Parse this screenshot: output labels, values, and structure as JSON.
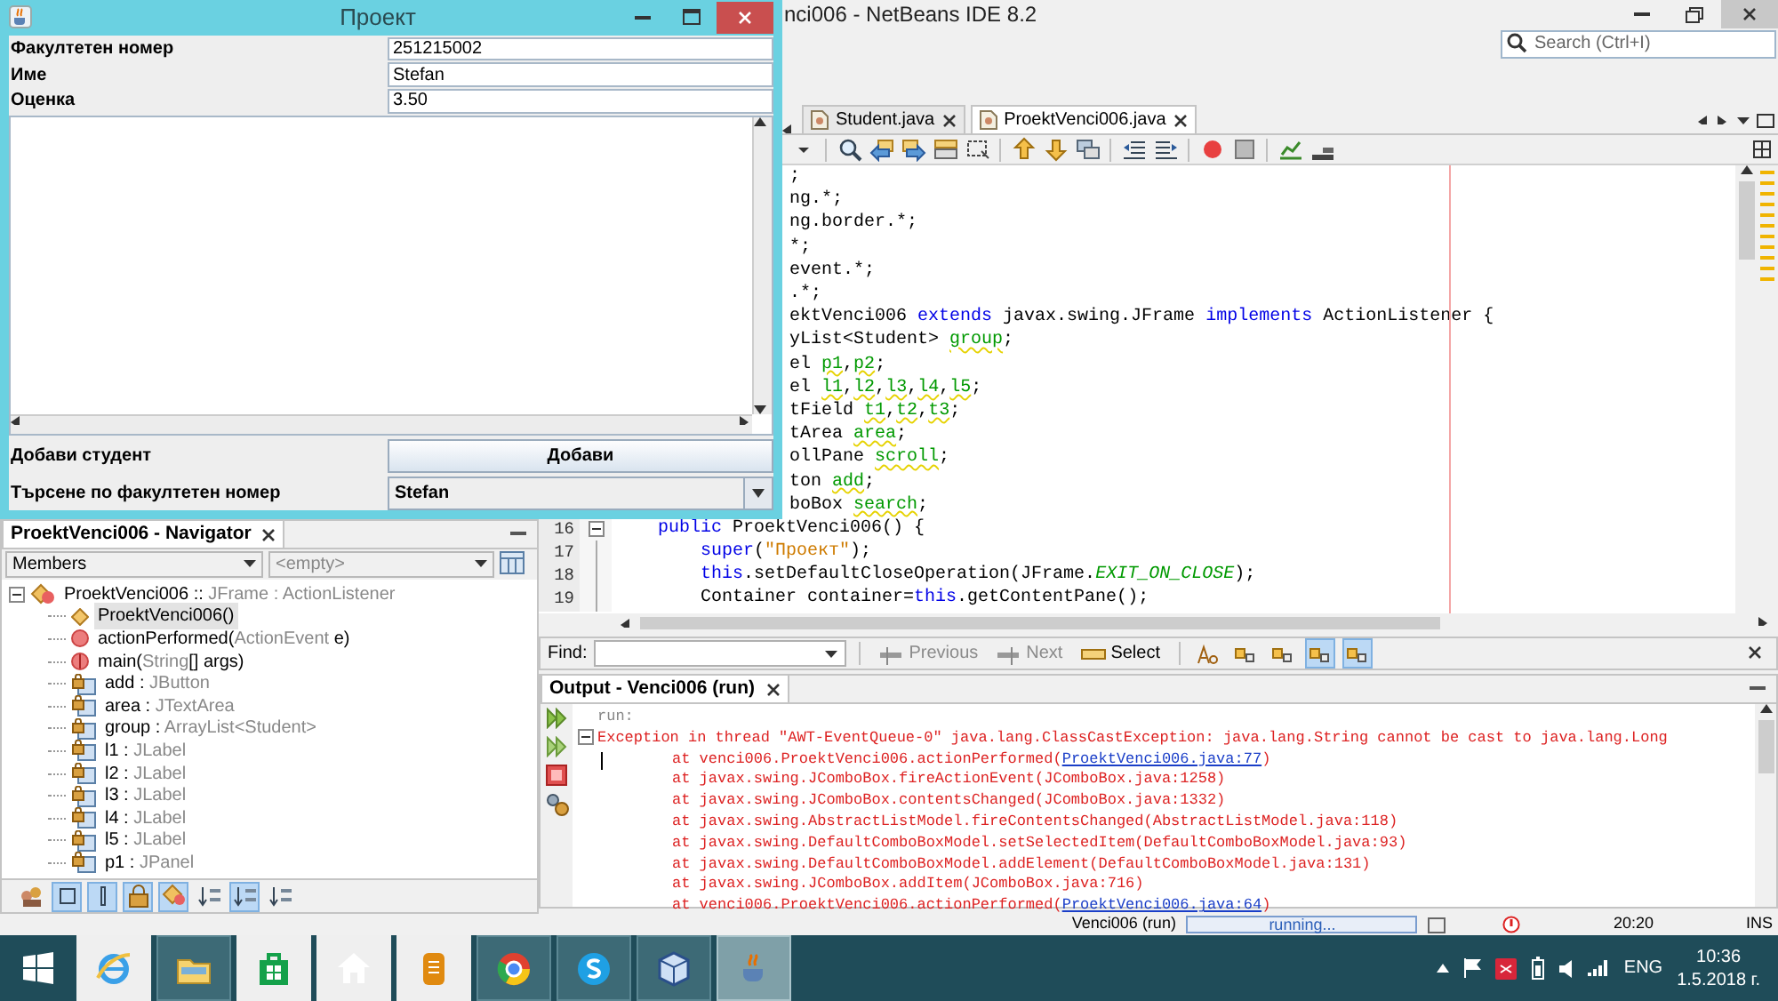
{
  "java_window": {
    "title": "Проект",
    "form": [
      {
        "label": "Факултетен номер",
        "value": "251215002"
      },
      {
        "label": "Име",
        "value": "Stefan"
      },
      {
        "label": "Оценка",
        "value": "3.50"
      }
    ],
    "add_label": "Добави студент",
    "add_button": "Добави",
    "search_label": "Търсене по факултетен номер",
    "search_value": "Stefan"
  },
  "ide": {
    "title": "nci006 - NetBeans IDE 8.2",
    "search": {
      "placeholder": "Search (Ctrl+I)"
    },
    "editor_tabs": [
      {
        "label": "Student.java",
        "selected": false
      },
      {
        "label": "ProektVenci006.java",
        "selected": true
      }
    ],
    "code_lines": [
      {
        "tokens": [
          {
            "text": ";",
            "kind": "plain"
          }
        ]
      },
      {
        "tokens": [
          {
            "text": "ng.*;",
            "kind": "plain"
          }
        ]
      },
      {
        "tokens": [
          {
            "text": "ng.border.*;",
            "kind": "plain"
          }
        ]
      },
      {
        "tokens": [
          {
            "text": "*;",
            "kind": "plain"
          }
        ]
      },
      {
        "tokens": [
          {
            "text": "event.*;",
            "kind": "plain"
          }
        ]
      },
      {
        "tokens": [
          {
            "text": ".*;",
            "kind": "plain"
          }
        ]
      },
      {
        "tokens": [
          {
            "text": "ektVenci006 ",
            "kind": "plain"
          },
          {
            "text": "extends",
            "kind": "keyword"
          },
          {
            "text": " javax.swing.JFrame ",
            "kind": "plain"
          },
          {
            "text": "implements",
            "kind": "keyword"
          },
          {
            "text": " ActionListener {",
            "kind": "plain"
          }
        ]
      },
      {
        "tokens": [
          {
            "text": "yList<Student> ",
            "kind": "plain"
          },
          {
            "text": "group",
            "kind": "field"
          },
          {
            "text": ";",
            "kind": "plain"
          }
        ]
      },
      {
        "tokens": [
          {
            "text": "el ",
            "kind": "plain"
          },
          {
            "text": "p1",
            "kind": "field"
          },
          {
            "text": ",",
            "kind": "plain"
          },
          {
            "text": "p2",
            "kind": "field"
          },
          {
            "text": ";",
            "kind": "plain"
          }
        ]
      },
      {
        "tokens": [
          {
            "text": "el ",
            "kind": "plain"
          },
          {
            "text": "l1",
            "kind": "field"
          },
          {
            "text": ",",
            "kind": "plain"
          },
          {
            "text": "l2",
            "kind": "field"
          },
          {
            "text": ",",
            "kind": "plain"
          },
          {
            "text": "l3",
            "kind": "field"
          },
          {
            "text": ",",
            "kind": "plain"
          },
          {
            "text": "l4",
            "kind": "field"
          },
          {
            "text": ",",
            "kind": "plain"
          },
          {
            "text": "l5",
            "kind": "field"
          },
          {
            "text": ";",
            "kind": "plain"
          }
        ]
      },
      {
        "tokens": [
          {
            "text": "tField ",
            "kind": "plain"
          },
          {
            "text": "t1",
            "kind": "field"
          },
          {
            "text": ",",
            "kind": "plain"
          },
          {
            "text": "t2",
            "kind": "field"
          },
          {
            "text": ",",
            "kind": "plain"
          },
          {
            "text": "t3",
            "kind": "field"
          },
          {
            "text": ";",
            "kind": "plain"
          }
        ]
      },
      {
        "tokens": [
          {
            "text": "tArea ",
            "kind": "plain"
          },
          {
            "text": "area",
            "kind": "field"
          },
          {
            "text": ";",
            "kind": "plain"
          }
        ]
      },
      {
        "tokens": [
          {
            "text": "ollPane ",
            "kind": "plain"
          },
          {
            "text": "scroll",
            "kind": "field"
          },
          {
            "text": ";",
            "kind": "plain"
          }
        ]
      },
      {
        "tokens": [
          {
            "text": "ton ",
            "kind": "plain"
          },
          {
            "text": "add",
            "kind": "field"
          },
          {
            "text": ";",
            "kind": "plain"
          }
        ]
      },
      {
        "tokens": [
          {
            "text": "boBox ",
            "kind": "plain"
          },
          {
            "text": "search",
            "kind": "field"
          },
          {
            "text": ";",
            "kind": "plain"
          }
        ]
      },
      {
        "number": "16",
        "fold": true,
        "tokens": [
          {
            "text": "    public",
            "kind": "keyword"
          },
          {
            "text": " ProektVenci006() {",
            "kind": "plain"
          }
        ]
      },
      {
        "number": "17",
        "fold": false,
        "tokens": [
          {
            "text": "        super",
            "kind": "keyword"
          },
          {
            "text": "(",
            "kind": "plain"
          },
          {
            "text": "\"Проект\"",
            "kind": "string"
          },
          {
            "text": ");",
            "kind": "plain"
          }
        ]
      },
      {
        "number": "18",
        "fold": false,
        "tokens": [
          {
            "text": "        this",
            "kind": "keyword"
          },
          {
            "text": ".setDefaultCloseOperation(JFrame.",
            "kind": "plain"
          },
          {
            "text": "EXIT_ON_CLOSE",
            "kind": "constant"
          },
          {
            "text": ");",
            "kind": "plain"
          }
        ]
      },
      {
        "number": "19",
        "fold": false,
        "tokens": [
          {
            "text": "        Container container=",
            "kind": "plain"
          },
          {
            "text": "this",
            "kind": "keyword"
          },
          {
            "text": ".getContentPane();",
            "kind": "plain"
          }
        ]
      }
    ],
    "find_bar": {
      "label": "Find:",
      "buttons": [
        {
          "label": "Previous",
          "disabled": true
        },
        {
          "label": "Next",
          "disabled": true
        },
        {
          "label": "Select",
          "disabled": false
        }
      ]
    },
    "output": {
      "tab": "Output - Venci006 (run)",
      "lines": [
        {
          "kind": "info",
          "parts": [
            {
              "text": "run:",
              "link": false
            }
          ]
        },
        {
          "kind": "error",
          "parts": [
            {
              "text": "Exception in thread \"AWT-EventQueue-0\" java.lang.ClassCastException: java.lang.String cannot be cast to java.lang.Long",
              "link": false
            }
          ]
        },
        {
          "kind": "stack",
          "parts": [
            {
              "text": "at venci006.ProektVenci006.actionPerformed(",
              "link": false
            },
            {
              "text": "ProektVenci006.java:77",
              "link": true
            },
            {
              "text": ")",
              "link": false
            }
          ]
        },
        {
          "kind": "stack",
          "parts": [
            {
              "text": "at javax.swing.JComboBox.fireActionEvent(JComboBox.java:1258)",
              "link": false
            }
          ]
        },
        {
          "kind": "stack",
          "parts": [
            {
              "text": "at javax.swing.JComboBox.contentsChanged(JComboBox.java:1332)",
              "link": false
            }
          ]
        },
        {
          "kind": "stack",
          "parts": [
            {
              "text": "at javax.swing.AbstractListModel.fireContentsChanged(AbstractListModel.java:118)",
              "link": false
            }
          ]
        },
        {
          "kind": "stack",
          "parts": [
            {
              "text": "at javax.swing.DefaultComboBoxModel.setSelectedItem(DefaultComboBoxModel.java:93)",
              "link": false
            }
          ]
        },
        {
          "kind": "stack",
          "parts": [
            {
              "text": "at javax.swing.DefaultComboBoxModel.addElement(DefaultComboBoxModel.java:131)",
              "link": false
            }
          ]
        },
        {
          "kind": "stack",
          "parts": [
            {
              "text": "at javax.swing.JComboBox.addItem(JComboBox.java:716)",
              "link": false
            }
          ]
        },
        {
          "kind": "stack",
          "parts": [
            {
              "text": "at venci006.ProektVenci006.actionPerformed(",
              "link": false
            },
            {
              "text": "ProektVenci006.java:64",
              "link": true
            },
            {
              "text": ")",
              "link": false
            }
          ]
        }
      ]
    },
    "status_bar": {
      "task": "Venci006 (run)",
      "progress": "running...",
      "position": "20:20",
      "mode": "INS"
    },
    "navigator": {
      "tab": "ProektVenci006 - Navigator",
      "filter": "Members",
      "scope": {
        "value": "<empty>",
        "disabled": true
      },
      "tree": {
        "kind": "class",
        "expanded": true,
        "selected": false,
        "parts": [
          {
            "text": "ProektVenci006 :: ",
            "muted": false
          },
          {
            "text": "JFrame : ActionListener",
            "muted": true
          }
        ],
        "children": [
          {
            "kind": "constructor",
            "selected": true,
            "parts": [
              {
                "text": "ProektVenci006()",
                "muted": false
              }
            ]
          },
          {
            "kind": "method",
            "selected": false,
            "parts": [
              {
                "text": "actionPerformed(",
                "muted": false
              },
              {
                "text": "ActionEvent",
                "muted": true
              },
              {
                "text": " e)",
                "muted": false
              }
            ]
          },
          {
            "kind": "static_method",
            "selected": false,
            "parts": [
              {
                "text": "main(",
                "muted": false
              },
              {
                "text": "String",
                "muted": true
              },
              {
                "text": "[] args)",
                "muted": false
              }
            ]
          },
          {
            "kind": "field",
            "selected": false,
            "parts": [
              {
                "text": "add : ",
                "muted": false
              },
              {
                "text": "JButton",
                "muted": true
              }
            ]
          },
          {
            "kind": "field",
            "selected": false,
            "parts": [
              {
                "text": "area : ",
                "muted": false
              },
              {
                "text": "JTextArea",
                "muted": true
              }
            ]
          },
          {
            "kind": "field",
            "selected": false,
            "parts": [
              {
                "text": "group : ",
                "muted": false
              },
              {
                "text": "ArrayList<Student>",
                "muted": true
              }
            ]
          },
          {
            "kind": "field",
            "selected": false,
            "parts": [
              {
                "text": "l1 : ",
                "muted": false
              },
              {
                "text": "JLabel",
                "muted": true
              }
            ]
          },
          {
            "kind": "field",
            "selected": false,
            "parts": [
              {
                "text": "l2 : ",
                "muted": false
              },
              {
                "text": "JLabel",
                "muted": true
              }
            ]
          },
          {
            "kind": "field",
            "selected": false,
            "parts": [
              {
                "text": "l3 : ",
                "muted": false
              },
              {
                "text": "JLabel",
                "muted": true
              }
            ]
          },
          {
            "kind": "field",
            "selected": false,
            "parts": [
              {
                "text": "l4 : ",
                "muted": false
              },
              {
                "text": "JLabel",
                "muted": true
              }
            ]
          },
          {
            "kind": "field",
            "selected": false,
            "parts": [
              {
                "text": "l5 : ",
                "muted": false
              },
              {
                "text": "JLabel",
                "muted": true
              }
            ]
          },
          {
            "kind": "field",
            "selected": false,
            "parts": [
              {
                "text": "p1 : ",
                "muted": false
              },
              {
                "text": "JPanel",
                "muted": true
              }
            ]
          }
        ]
      }
    }
  },
  "taskbar": {
    "apps": [
      {
        "open": false,
        "active": false
      },
      {
        "open": true,
        "active": false
      },
      {
        "open": false,
        "active": false
      },
      {
        "open": false,
        "active": false
      },
      {
        "open": false,
        "active": false
      },
      {
        "open": true,
        "active": false
      },
      {
        "open": true,
        "active": false
      },
      {
        "open": true,
        "active": false
      },
      {
        "open": true,
        "active": true
      }
    ],
    "language": "ENG",
    "time": "10:36",
    "date": "1.5.2018 г."
  }
}
